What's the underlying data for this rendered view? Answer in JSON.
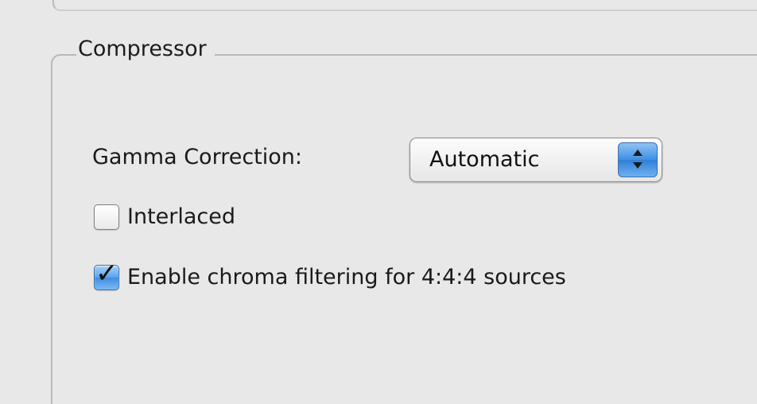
{
  "group": {
    "title": "Compressor"
  },
  "gamma": {
    "label": "Gamma Correction:",
    "selected": "Automatic"
  },
  "options": {
    "interlaced": {
      "label": "Interlaced",
      "checked": false
    },
    "chroma_filtering": {
      "label": "Enable chroma filtering for 4:4:4 sources",
      "checked": true,
      "checkmark": "✓"
    }
  },
  "colors": {
    "background": "#e8e8e8",
    "accent_blue": "#3d8ee4",
    "group_border": "#b9b9b9"
  },
  "icons": {
    "popup_arrows": "up-down-arrows-icon",
    "checkmark": "checkmark-icon"
  }
}
